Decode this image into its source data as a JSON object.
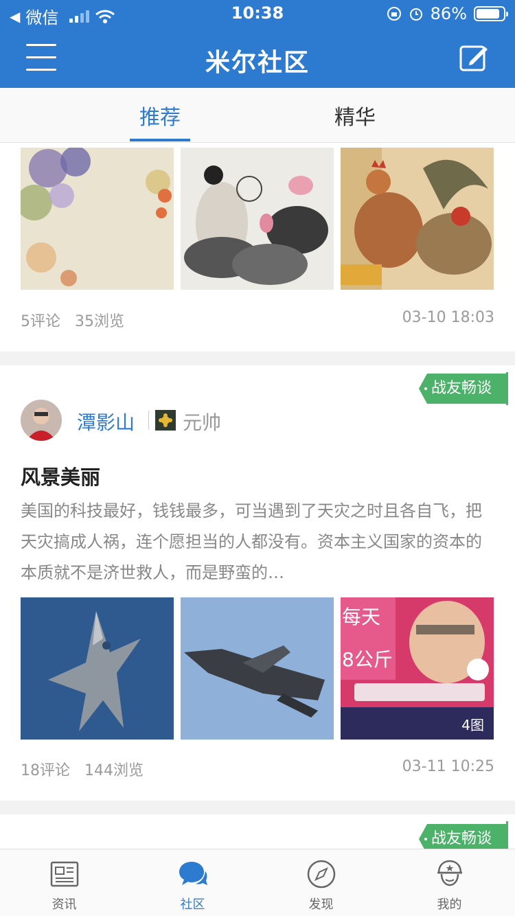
{
  "status_bar": {
    "back_app": "微信",
    "time": "10:38",
    "battery": "86%",
    "battery_level": 0.86
  },
  "nav": {
    "title": "米尔社区"
  },
  "tabs": [
    {
      "label": "推荐",
      "active": true
    },
    {
      "label": "精华",
      "active": false
    }
  ],
  "posts": [
    {
      "comments": "5评论",
      "views": "35浏览",
      "time": "03-10 18:03"
    },
    {
      "tag": "战友畅谈",
      "username": "潭影山",
      "rank": "元帅",
      "title": "风景美丽",
      "body": "美国的科技最好，钱钱最多，可当遇到了天灾之时且各自飞，把天灾搞成人祸，连个愿担当的人都没有。资本主义国家的资本的本质就不是济世救人，而是野蛮的…",
      "image_count": "4图",
      "comments": "18评论",
      "views": "144浏览",
      "time": "03-11 10:25"
    },
    {
      "tag": "战友畅谈"
    }
  ],
  "tabbar": [
    {
      "label": "资讯",
      "icon": "news-icon",
      "active": false
    },
    {
      "label": "社区",
      "icon": "chat-bubbles-icon",
      "active": true
    },
    {
      "label": "发现",
      "icon": "compass-icon",
      "active": false
    },
    {
      "label": "我的",
      "icon": "soldier-icon",
      "active": false
    }
  ],
  "colors": {
    "primary": "#2d7bd0",
    "tag_green": "#4cb26a"
  }
}
